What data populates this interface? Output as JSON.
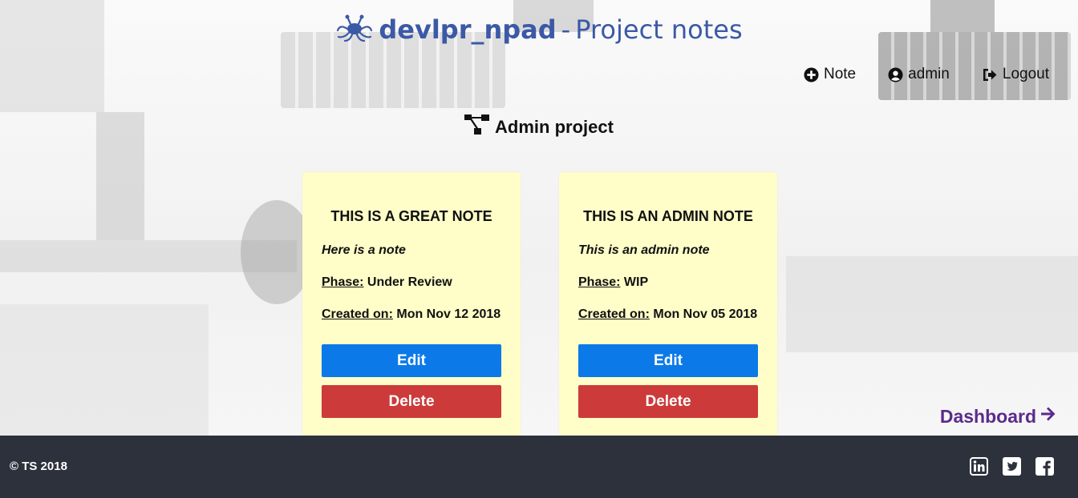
{
  "header": {
    "brand": "devlpr_npad",
    "separator": "-",
    "subtitle": "Project notes",
    "logo_icon": "spaghetti-monster-icon",
    "color": "#3b59a6"
  },
  "nav": {
    "note_label": "Note",
    "note_icon": "plus-circle-icon",
    "user_label": "admin",
    "user_icon": "user-circle-icon",
    "logout_label": "Logout",
    "logout_icon": "sign-out-icon"
  },
  "project": {
    "title": "Admin project",
    "icon": "sitemap-icon"
  },
  "notes": [
    {
      "title": "THIS IS A GREAT NOTE",
      "description": "Here is a note",
      "phase_label": "Phase:",
      "phase": "Under Review",
      "created_label": "Created on:",
      "created": "Mon Nov 12 2018",
      "edit_label": "Edit",
      "delete_label": "Delete"
    },
    {
      "title": "THIS IS AN ADMIN NOTE",
      "description": "This is an admin note",
      "phase_label": "Phase:",
      "phase": "WIP",
      "created_label": "Created on:",
      "created": "Mon Nov 05 2018",
      "edit_label": "Edit",
      "delete_label": "Delete"
    }
  ],
  "dashboard": {
    "label": "Dashboard",
    "icon": "arrow-right-icon",
    "color": "#5b2b8c"
  },
  "footer": {
    "copyright": "© TS 2018",
    "social_icons": [
      "linkedin-icon",
      "twitter-icon",
      "facebook-icon"
    ]
  },
  "colors": {
    "card_bg": "#fffdc8",
    "edit": "#0b7ae8",
    "delete": "#cc3a3a",
    "footer_bg": "#2c313c"
  }
}
